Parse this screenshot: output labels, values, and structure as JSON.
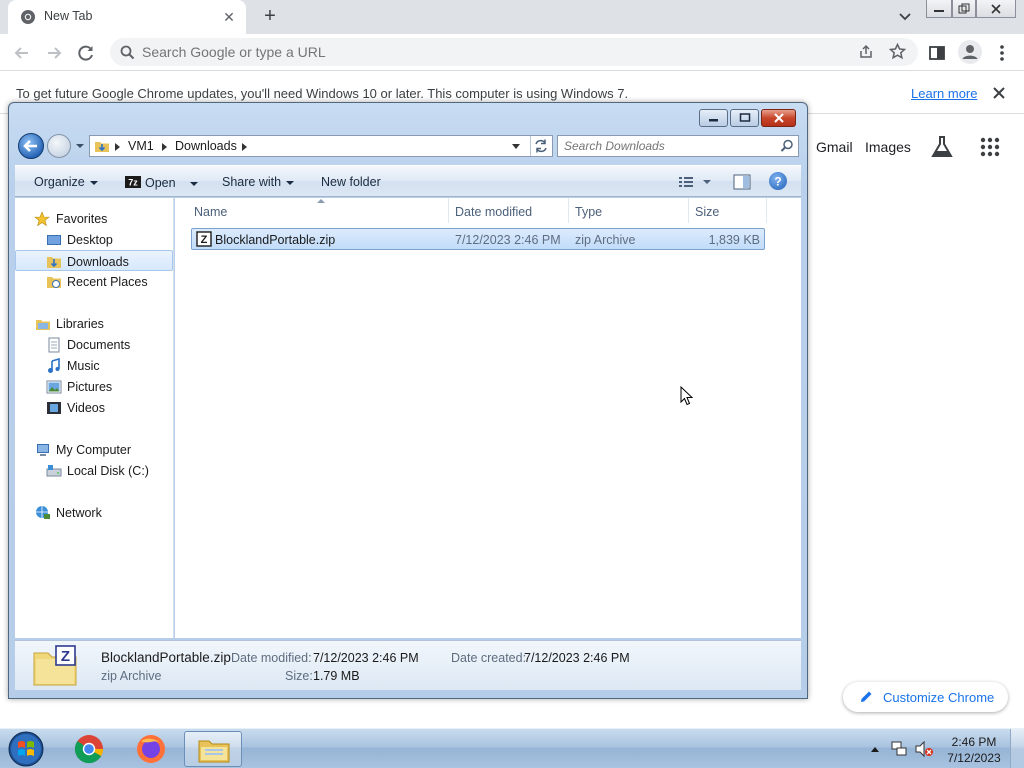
{
  "chrome": {
    "tab": {
      "title": "New Tab",
      "favicon": "chrome-icon"
    },
    "omnibox": {
      "placeholder": "Search Google or type a URL"
    },
    "infobar": {
      "message": "To get future Google Chrome updates, you'll need Windows 10 or later. This computer is using Windows 7.",
      "link": "Learn more"
    },
    "ntp": {
      "gmail": "Gmail",
      "images": "Images",
      "customize": "Customize Chrome"
    }
  },
  "explorer": {
    "breadcrumb": [
      "VM1",
      "Downloads"
    ],
    "search_placeholder": "Search Downloads",
    "commands": {
      "organize": "Organize",
      "open": "Open",
      "share_with": "Share with",
      "new_folder": "New folder"
    },
    "nav": {
      "favorites": "Favorites",
      "desktop": "Desktop",
      "downloads": "Downloads",
      "recent_places": "Recent Places",
      "libraries": "Libraries",
      "documents": "Documents",
      "music": "Music",
      "pictures": "Pictures",
      "videos": "Videos",
      "my_computer": "My Computer",
      "local_disk": "Local Disk (C:)",
      "network": "Network"
    },
    "columns": {
      "name": "Name",
      "date_modified": "Date modified",
      "type": "Type",
      "size": "Size"
    },
    "files": [
      {
        "name": "BlocklandPortable.zip",
        "date_modified": "7/12/2023 2:46 PM",
        "type": "zip Archive",
        "size": "1,839 KB"
      }
    ],
    "details": {
      "name": "BlocklandPortable.zip",
      "type": "zip Archive",
      "date_modified_label": "Date modified:",
      "date_modified": "7/12/2023 2:46 PM",
      "date_created_label": "Date created:",
      "date_created": "7/12/2023 2:46 PM",
      "size_label": "Size:",
      "size": "1.79 MB"
    }
  },
  "taskbar": {
    "time": "2:46 PM",
    "date": "7/12/2023"
  },
  "colors": {
    "chrome_accent": "#1a73e8",
    "selection": "#cce4fb",
    "taskbar": "#a9c3df"
  }
}
